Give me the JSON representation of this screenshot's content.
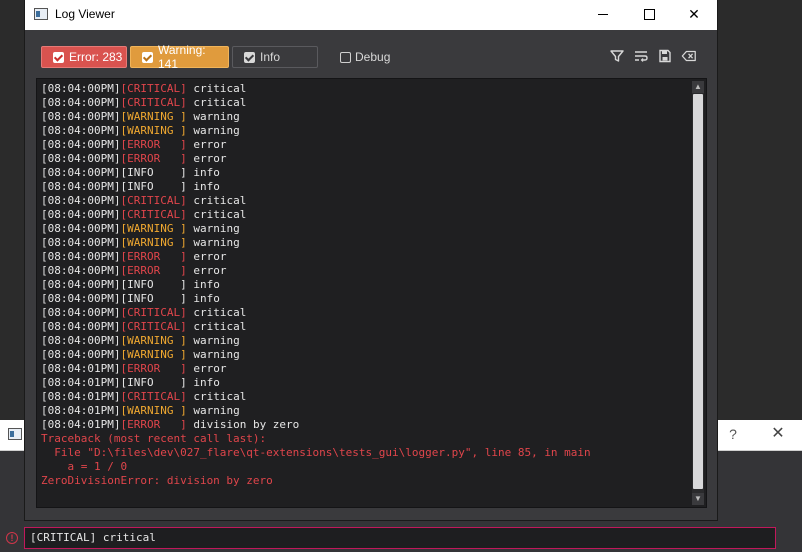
{
  "window": {
    "title": "Log Viewer"
  },
  "toolbar": {
    "error_label": "Error: 283",
    "warning_label": "Warning: 141",
    "info_label": "Info",
    "debug_label": "Debug",
    "icons": [
      "filter-icon",
      "wrap-lines-icon",
      "save-icon",
      "clear-icon"
    ]
  },
  "log": {
    "lines": [
      {
        "ts": "[08:04:00PM]",
        "level": "[CRITICAL]",
        "kind": "critical",
        "msg": " critical"
      },
      {
        "ts": "[08:04:00PM]",
        "level": "[CRITICAL]",
        "kind": "critical",
        "msg": " critical"
      },
      {
        "ts": "[08:04:00PM]",
        "level": "[WARNING ]",
        "kind": "warning",
        "msg": " warning"
      },
      {
        "ts": "[08:04:00PM]",
        "level": "[WARNING ]",
        "kind": "warning",
        "msg": " warning"
      },
      {
        "ts": "[08:04:00PM]",
        "level": "[ERROR   ]",
        "kind": "error",
        "msg": " error"
      },
      {
        "ts": "[08:04:00PM]",
        "level": "[ERROR   ]",
        "kind": "error",
        "msg": " error"
      },
      {
        "ts": "[08:04:00PM]",
        "level": "[INFO    ]",
        "kind": "info",
        "msg": " info"
      },
      {
        "ts": "[08:04:00PM]",
        "level": "[INFO    ]",
        "kind": "info",
        "msg": " info"
      },
      {
        "ts": "[08:04:00PM]",
        "level": "[CRITICAL]",
        "kind": "critical",
        "msg": " critical"
      },
      {
        "ts": "[08:04:00PM]",
        "level": "[CRITICAL]",
        "kind": "critical",
        "msg": " critical"
      },
      {
        "ts": "[08:04:00PM]",
        "level": "[WARNING ]",
        "kind": "warning",
        "msg": " warning"
      },
      {
        "ts": "[08:04:00PM]",
        "level": "[WARNING ]",
        "kind": "warning",
        "msg": " warning"
      },
      {
        "ts": "[08:04:00PM]",
        "level": "[ERROR   ]",
        "kind": "error",
        "msg": " error"
      },
      {
        "ts": "[08:04:00PM]",
        "level": "[ERROR   ]",
        "kind": "error",
        "msg": " error"
      },
      {
        "ts": "[08:04:00PM]",
        "level": "[INFO    ]",
        "kind": "info",
        "msg": " info"
      },
      {
        "ts": "[08:04:00PM]",
        "level": "[INFO    ]",
        "kind": "info",
        "msg": " info"
      },
      {
        "ts": "[08:04:00PM]",
        "level": "[CRITICAL]",
        "kind": "critical",
        "msg": " critical"
      },
      {
        "ts": "[08:04:00PM]",
        "level": "[CRITICAL]",
        "kind": "critical",
        "msg": " critical"
      },
      {
        "ts": "[08:04:00PM]",
        "level": "[WARNING ]",
        "kind": "warning",
        "msg": " warning"
      },
      {
        "ts": "[08:04:00PM]",
        "level": "[WARNING ]",
        "kind": "warning",
        "msg": " warning"
      },
      {
        "ts": "[08:04:01PM]",
        "level": "[ERROR   ]",
        "kind": "error",
        "msg": " error"
      },
      {
        "ts": "[08:04:01PM]",
        "level": "[INFO    ]",
        "kind": "info",
        "msg": " info"
      },
      {
        "ts": "[08:04:01PM]",
        "level": "[CRITICAL]",
        "kind": "critical",
        "msg": " critical"
      },
      {
        "ts": "[08:04:01PM]",
        "level": "[WARNING ]",
        "kind": "warning",
        "msg": " warning"
      },
      {
        "ts": "[08:04:01PM]",
        "level": "[ERROR   ]",
        "kind": "error",
        "msg": " division by zero"
      }
    ],
    "traceback": [
      "Traceback (most recent call last):",
      "  File \"D:\\files\\dev\\027_flare\\qt-extensions\\tests_gui\\logger.py\", line 85, in main",
      "    a = 1 / 0",
      "ZeroDivisionError: division by zero"
    ]
  },
  "background_window": {
    "input_value": "[CRITICAL] critical"
  },
  "colors": {
    "error": "#d9534f",
    "warning": "#e09b3d",
    "critical_text": "#e0454b",
    "warning_text": "#f0a830"
  }
}
